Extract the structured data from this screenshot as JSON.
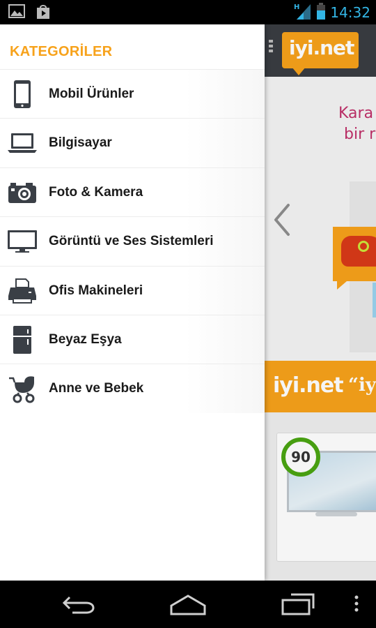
{
  "status_bar": {
    "time": "14:32",
    "network_type": "H",
    "icons": [
      "gallery-icon",
      "play-store-icon",
      "signal-icon",
      "battery-icon"
    ]
  },
  "main_app": {
    "logo": "iyi.net",
    "banner_line1": "Kara",
    "banner_line2": "bir r",
    "footer_logo": "iyi.net",
    "footer_slogan": "“iy",
    "product_score": "90"
  },
  "drawer": {
    "title": "KATEGORİLER",
    "items": [
      {
        "label": "Mobil Ürünler",
        "icon": "mobile-phone-icon"
      },
      {
        "label": "Bilgisayar",
        "icon": "laptop-icon"
      },
      {
        "label": "Foto & Kamera",
        "icon": "camera-icon"
      },
      {
        "label": "Görüntü ve Ses Sistemleri",
        "icon": "monitor-icon"
      },
      {
        "label": "Ofis Makineleri",
        "icon": "printer-icon"
      },
      {
        "label": "Beyaz Eşya",
        "icon": "refrigerator-icon"
      },
      {
        "label": "Anne ve Bebek",
        "icon": "stroller-icon"
      }
    ]
  },
  "colors": {
    "accent": "#f7a21b",
    "topbar": "#3a3d42",
    "status_blue": "#33b5e5",
    "score_ring": "#4aa512",
    "banner_text": "#c0306a"
  }
}
